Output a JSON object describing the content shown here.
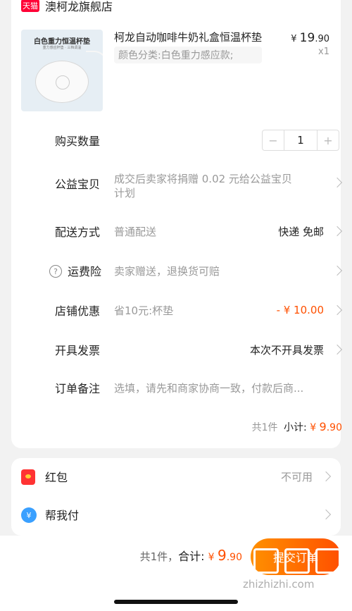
{
  "store": {
    "badge": "天猫",
    "name": "澳柯龙旗舰店"
  },
  "product": {
    "thumb_title": "白色重力恒温杯垫",
    "thumb_sub": "重力感应杯垫 · 三档调温",
    "title": "柯龙自动咖啡牛奶礼盒恒温杯垫",
    "variant": "颜色分类:白色重力感应款;",
    "price_symbol": "¥",
    "price_int": "19",
    "price_dec": ".90",
    "qty": "x1"
  },
  "rows": {
    "quantity_label": "购买数量",
    "quantity_value": "1",
    "charity_label": "公益宝贝",
    "charity_value": "成交后卖家将捐赠 0.02 元给公益宝贝",
    "charity_value2": "计划",
    "delivery_label": "配送方式",
    "delivery_value": "普通配送",
    "delivery_right": "快递 免邮",
    "insurance_label": "运费险",
    "insurance_value": "卖家赠送，退换货可赔",
    "discount_label": "店铺优惠",
    "discount_value": "省10元:杯垫",
    "discount_right": "- ¥ 10.00",
    "invoice_label": "开具发票",
    "invoice_right": "本次不开具发票",
    "note_label": "订单备注",
    "note_placeholder": "选填，请先和商家协商一致，付款后商..."
  },
  "subtotal": {
    "count": "共1件",
    "label": "小计:",
    "symbol": "¥ ",
    "int": "9",
    "dec": ".90"
  },
  "extras": {
    "hongbao_label": "红包",
    "hongbao_right": "不可用",
    "helppay_label": "帮我付"
  },
  "footer": {
    "count": "共1件，",
    "total_label": "合计:",
    "symbol": "¥ ",
    "int": "9",
    "dec": ".90",
    "submit": "提交订单"
  },
  "watermark": "zhizhizhi.com",
  "colors": {
    "accent": "#ff5000",
    "tmall": "#ff0036"
  }
}
